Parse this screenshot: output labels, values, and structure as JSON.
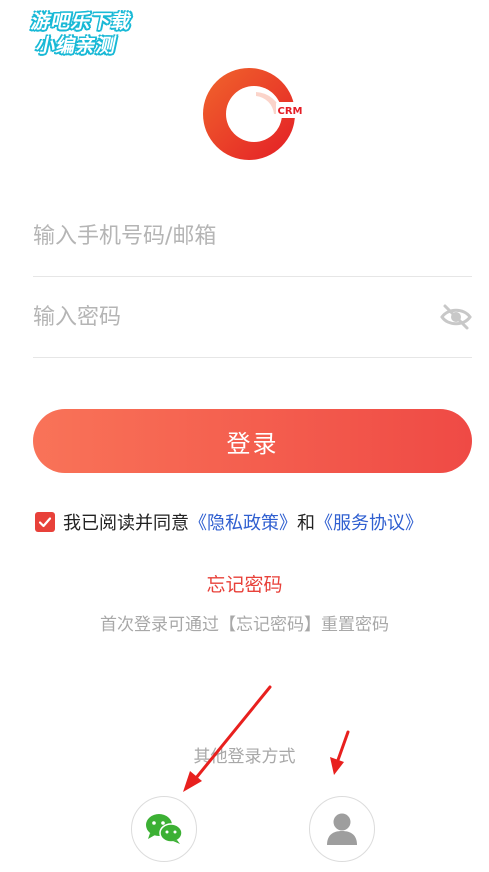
{
  "watermark": {
    "line1": "游吧乐下载",
    "line2": "小编亲测"
  },
  "logo": {
    "text": "CRM",
    "icon": "crm-logo"
  },
  "form": {
    "phone_placeholder": "输入手机号码/邮箱",
    "password_placeholder": "输入密码",
    "password_toggle_icon": "eye-hidden-icon"
  },
  "login_button": "登录",
  "agreement": {
    "checked": true,
    "prefix": "我已阅读并同意",
    "privacy": "《隐私政策》",
    "and": "和",
    "service": "《服务协议》"
  },
  "forgot_password": "忘记密码",
  "hint": "首次登录可通过【忘记密码】重置密码",
  "other_login": {
    "label": "其他登录方式",
    "options": [
      {
        "name": "wechat",
        "icon": "wechat-icon"
      },
      {
        "name": "account",
        "icon": "user-icon"
      }
    ]
  },
  "colors": {
    "accent": "#e8413a",
    "gradient_start": "#f97358",
    "gradient_end": "#ef4a45",
    "link": "#2f5fd0",
    "wechat": "#3cb034",
    "annotation_arrow": "#e8201e"
  }
}
